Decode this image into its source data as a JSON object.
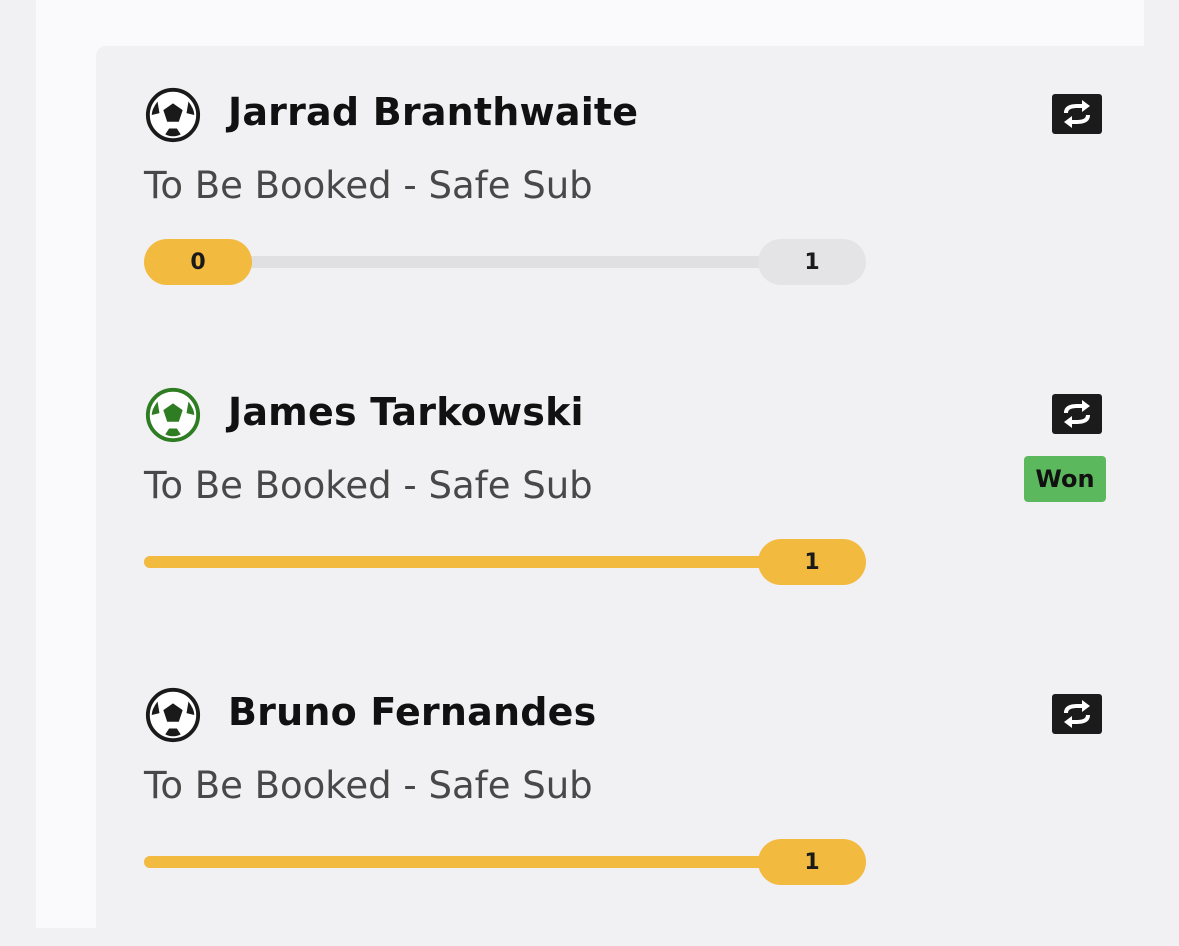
{
  "selections": [
    {
      "player": "Jarrad Branthwaite",
      "market": "To Be Booked - Safe Sub",
      "ball_icon": "soccer-ball-icon",
      "ball_color": "#1a1a1a",
      "swap_icon": "swap-icon",
      "status": "",
      "progress": {
        "current": "0",
        "target": "1",
        "fraction": 0
      }
    },
    {
      "player": "James Tarkowski",
      "market": "To Be Booked - Safe Sub",
      "ball_icon": "soccer-ball-icon",
      "ball_color": "#2f7d22",
      "swap_icon": "swap-icon",
      "status": "Won",
      "progress": {
        "current": "",
        "target": "1",
        "fraction": 1
      }
    },
    {
      "player": "Bruno Fernandes",
      "market": "To Be Booked - Safe Sub",
      "ball_icon": "soccer-ball-icon",
      "ball_color": "#1a1a1a",
      "swap_icon": "swap-icon",
      "status": "",
      "progress": {
        "current": "",
        "target": "1",
        "fraction": 1
      }
    }
  ],
  "colors": {
    "progress_fill": "#f2ba3e",
    "progress_track": "#e0e0e2",
    "won_badge": "#5cb85c",
    "swap_button": "#1b1b1b"
  }
}
